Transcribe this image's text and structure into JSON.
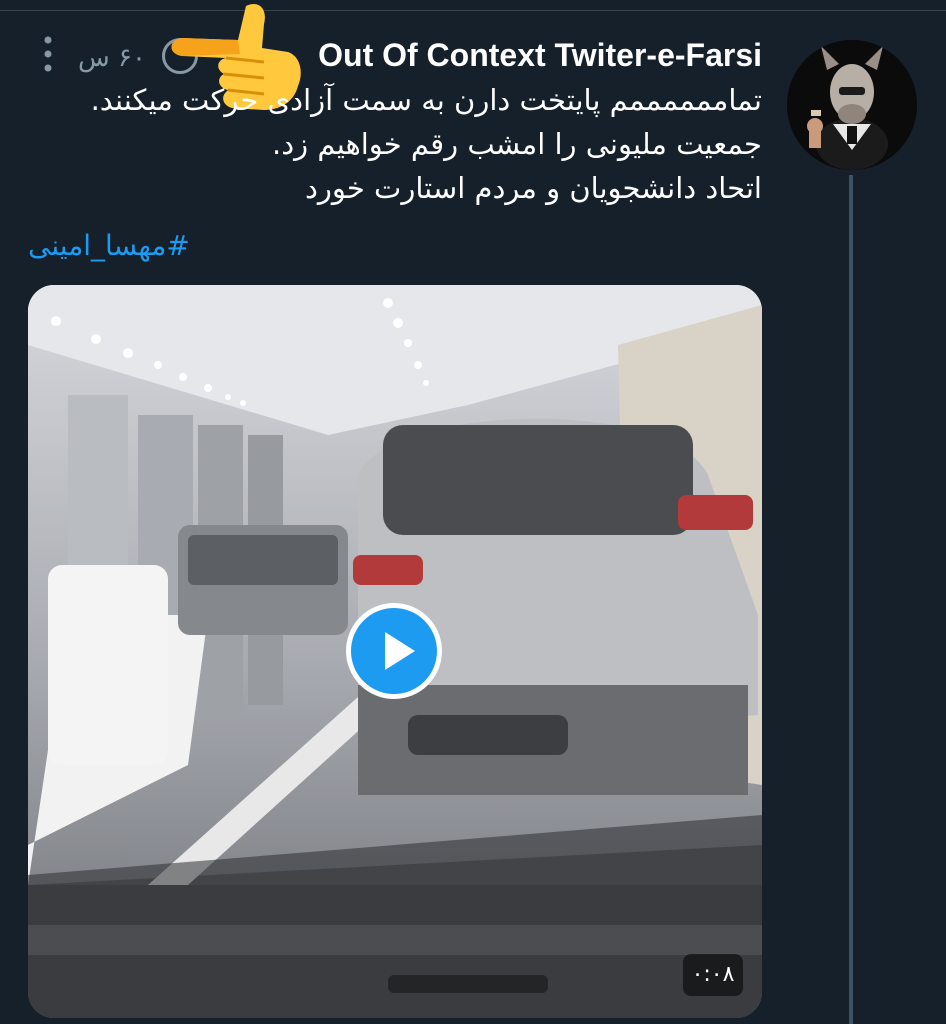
{
  "tweet": {
    "author_name": "Out Of Context Twiter-e-Farsi",
    "timestamp": "۶۰ س",
    "lines": [
      "تماممممممم پایتخت دارن به سمت آزادی حرکت میکنند.",
      "جمعیت ملیونی را امشب رقم خواهیم زد.",
      "اتحاد دانشجویان و مردم استارت خورد"
    ],
    "hashtag": "#مهسا_امینی",
    "media": {
      "duration": "۰:۰۸"
    }
  },
  "icons": {
    "more": "more-vertical-icon",
    "verified": "verified-badge-icon",
    "play": "play-icon",
    "pointing": "backhand-index-pointing-left-emoji"
  },
  "colors": {
    "background": "#15202b",
    "accent": "#1d9bf0",
    "secondary_text": "#8899a6",
    "thread_line": "#3d5466"
  }
}
